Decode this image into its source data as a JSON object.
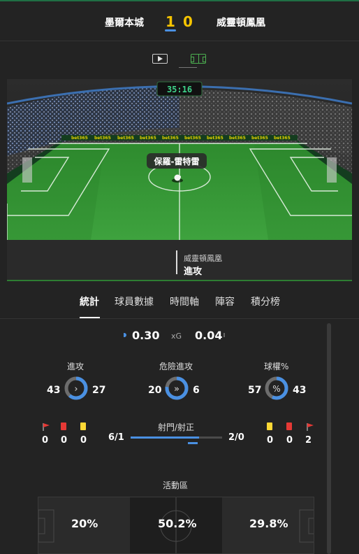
{
  "match": {
    "home_team": "墨爾本城",
    "away_team": "威靈頓鳳凰",
    "home_score": "1",
    "away_score": "0",
    "clock": "35:16"
  },
  "view_switch": {
    "video_icon": "play-icon",
    "pitch_icon": "pitch-icon"
  },
  "stadium": {
    "player_label": "保羅-雷特雷",
    "ad_text": "bet365",
    "event_team": "威靈頓鳳凰",
    "event_action": "進攻"
  },
  "tabs": [
    {
      "label": "統計",
      "active": true
    },
    {
      "label": "球員數據",
      "active": false
    },
    {
      "label": "時間軸",
      "active": false
    },
    {
      "label": "陣容",
      "active": false
    },
    {
      "label": "積分榜",
      "active": false
    }
  ],
  "xg": {
    "home": "0.30",
    "label": "xG",
    "away": "0.04"
  },
  "stats": [
    {
      "title": "進攻",
      "home": "43",
      "away": "27",
      "home_value": 43,
      "away_value": 27,
      "icon": "chevron-right-icon",
      "icon_glyph": "›"
    },
    {
      "title": "危險進攻",
      "home": "20",
      "away": "6",
      "home_value": 20,
      "away_value": 6,
      "icon": "double-chevron-icon",
      "icon_glyph": "»"
    },
    {
      "title": "球權%",
      "home": "57",
      "away": "43",
      "home_value": 57,
      "away_value": 43,
      "icon": "percent-icon",
      "icon_glyph": "%"
    }
  ],
  "cards": {
    "home": {
      "corners": "0",
      "red": "0",
      "yellow": "0"
    },
    "away": {
      "yellow": "0",
      "red": "0",
      "corners": "2"
    }
  },
  "shots": {
    "title": "射門/射正",
    "home": "6/1",
    "away": "2/0",
    "home_share": 0.75
  },
  "activity": {
    "title": "活動區",
    "home_zone": "20%",
    "middle_zone": "50.2%",
    "away_zone": "29.8%"
  },
  "colors": {
    "score": "#f5c400",
    "home_accent": "#4a90e2",
    "away_accent": "#6d6d6d",
    "pitch": "#2f8a2f",
    "red_card": "#e53935",
    "yellow_card": "#fdd835",
    "corner_flag": "#e53935"
  }
}
